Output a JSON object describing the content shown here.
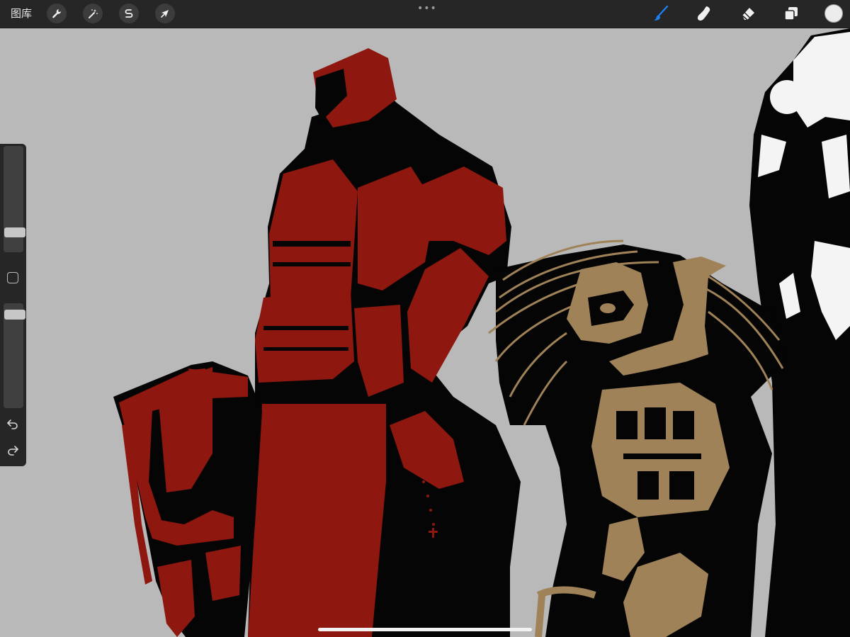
{
  "topbar": {
    "gallery_label": "图库",
    "left_tools": [
      {
        "name": "actions",
        "icon": "wrench-icon"
      },
      {
        "name": "adjustments",
        "icon": "magic-wand-icon"
      },
      {
        "name": "selection",
        "icon": "selection-s-icon"
      },
      {
        "name": "transform",
        "icon": "arrow-cursor-icon"
      }
    ],
    "more_label": "•••",
    "right_tools": [
      {
        "name": "brush",
        "icon": "brush-icon",
        "active": true
      },
      {
        "name": "smudge",
        "icon": "smudge-finger-icon"
      },
      {
        "name": "eraser",
        "icon": "eraser-icon"
      },
      {
        "name": "layers",
        "icon": "layers-icon"
      },
      {
        "name": "color",
        "icon": "color-chip-icon",
        "value": "#ececec"
      }
    ]
  },
  "sidebar": {
    "brush_size": 0.2,
    "brush_opacity": 0.93,
    "controls": [
      {
        "name": "modifier",
        "icon": "square-modifier-icon"
      },
      {
        "name": "undo",
        "icon": "undo-arrow-icon"
      },
      {
        "name": "redo",
        "icon": "redo-arrow-icon"
      }
    ]
  },
  "canvas": {
    "background": "#b9b9b9",
    "palette": {
      "red": "#8e170f",
      "black": "#050505",
      "gold": "#a08258",
      "white": "#f4f4f4"
    },
    "figures": [
      "armored-shield-soldier",
      "masked-soldier-with-rifle",
      "white-partial-figure"
    ]
  },
  "colors": {
    "accent": "#1e7ef0",
    "toolbar_bg": "#262626"
  }
}
